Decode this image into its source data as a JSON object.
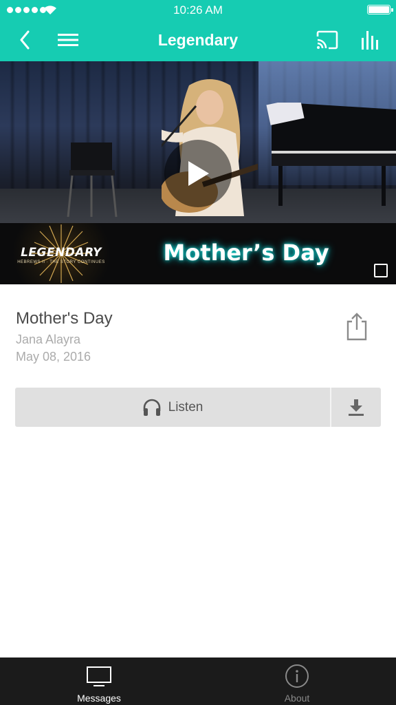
{
  "status_bar": {
    "time": "10:26 AM"
  },
  "nav": {
    "title": "Legendary"
  },
  "video": {
    "banner_logo_text": "LEGENDARY",
    "banner_logo_subtext": "HEBREWS II · THE STORY CONTINUES",
    "banner_title": "Mother’s Day"
  },
  "message": {
    "title": "Mother's Day",
    "speaker": "Jana Alayra",
    "date": "May 08, 2016"
  },
  "actions": {
    "listen_label": "Listen"
  },
  "tabs": [
    {
      "label": "Messages",
      "icon": "tv-icon",
      "active": true
    },
    {
      "label": "About",
      "icon": "info-icon",
      "active": false
    }
  ],
  "colors": {
    "accent": "#16ccb2",
    "tabbar": "#1b1b1b",
    "button_bg": "#e0e0e0",
    "title_text": "#4a4a4a",
    "secondary_text": "#ababab"
  },
  "icons": [
    "back-icon",
    "hamburger-menu-icon",
    "cast-icon",
    "stats-icon",
    "play-icon",
    "share-icon",
    "headphones-icon",
    "download-icon"
  ]
}
